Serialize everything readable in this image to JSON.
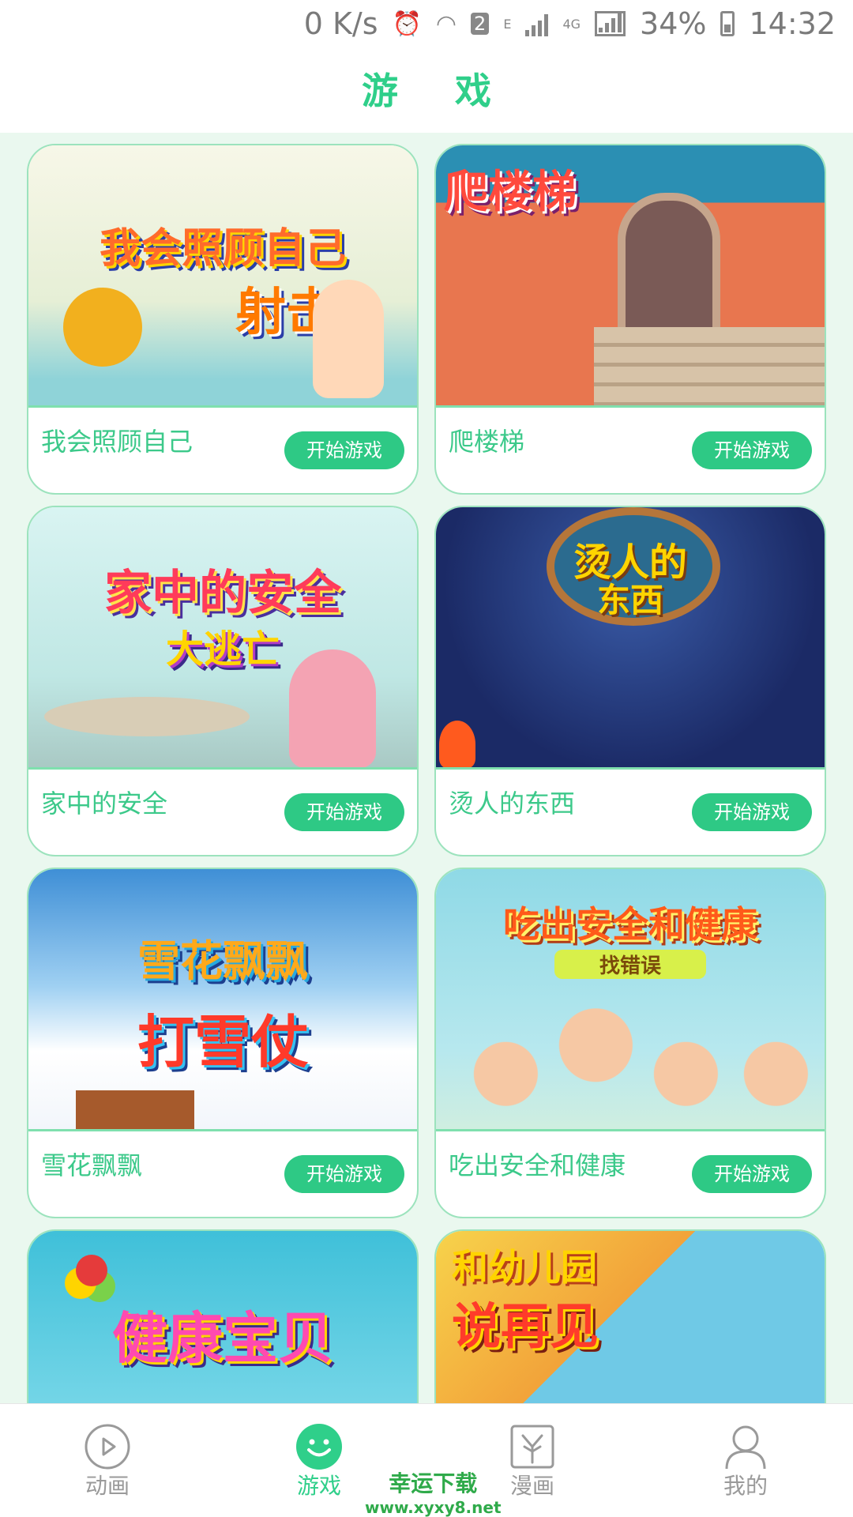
{
  "status_bar": {
    "speed": "0 K/s",
    "sim": "2",
    "net_e": "E",
    "net_4g": "4G",
    "battery": "34%",
    "time": "14:32"
  },
  "header": {
    "title": "游 戏"
  },
  "games": [
    {
      "name": "我会照顾自己",
      "button": "开始游戏",
      "art_line1": "我会照顾自己",
      "art_line2": "射击"
    },
    {
      "name": "爬楼梯",
      "button": "开始游戏",
      "art_line1": "爬楼梯",
      "art_line2": ""
    },
    {
      "name": "家中的安全",
      "button": "开始游戏",
      "art_line1": "家中的安全",
      "art_line2": "大逃亡"
    },
    {
      "name": "烫人的东西",
      "button": "开始游戏",
      "art_line1": "烫人的",
      "art_line2": "东西"
    },
    {
      "name": "雪花飘飘",
      "button": "开始游戏",
      "art_line1": "雪花飘飘",
      "art_line2": "打雪仗"
    },
    {
      "name": "吃出安全和健康",
      "button": "开始游戏",
      "art_line1": "吃出安全和健康",
      "art_line2": "找错误"
    },
    {
      "name": "",
      "button": "",
      "art_line1": "健康宝贝",
      "art_line2": ""
    },
    {
      "name": "",
      "button": "",
      "art_line1": "和幼儿园",
      "art_line2": "说再见"
    }
  ],
  "tabs": [
    {
      "label": "动画",
      "icon": "play-circle-icon",
      "active": false
    },
    {
      "label": "游戏",
      "icon": "smiley-icon",
      "active": true
    },
    {
      "label": "漫画",
      "icon": "comic-icon",
      "active": false
    },
    {
      "label": "我的",
      "icon": "user-icon",
      "active": false
    }
  ],
  "watermark": {
    "line1": "幸运下载",
    "line2": "www.xyxy8.net"
  },
  "colors": {
    "accent": "#2fcf8a",
    "button": "#2ec985",
    "card_border": "#9ce3bd"
  }
}
